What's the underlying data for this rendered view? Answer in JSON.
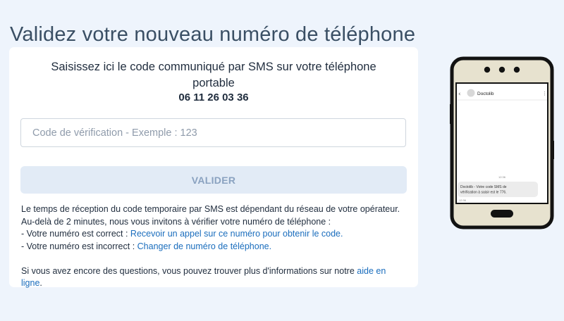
{
  "page": {
    "title": "Validez votre nouveau numéro de téléphone"
  },
  "form": {
    "instruction": "Saisissez ici le code communiqué par SMS sur votre téléphone portable",
    "phone_number": "06 11 26 03 36",
    "code_input": {
      "value": "",
      "placeholder": "Code de vérification - Exemple : 123"
    },
    "validate_label": "VALIDER"
  },
  "info": {
    "paragraph": "Le temps de réception du code temporaire par SMS est dépendant du réseau de votre opérateur. Au-delà de 2 minutes, nous vous invitons à vérifier votre numéro de téléphone :",
    "correct_prefix": "- Votre numéro est correct : ",
    "correct_link": "Recevoir un appel sur ce numéro pour obtenir le code.",
    "incorrect_prefix": "- Votre numéro est incorrect : ",
    "incorrect_link": "Changer de numéro de téléphone.",
    "help_prefix": "Si vous avez encore des questions, vous pouvez trouver plus d'informations sur notre ",
    "help_link": "aide en ligne",
    "help_suffix": "."
  },
  "phone_mockup": {
    "sender": "Doctolib",
    "timestamp_top": "12:36",
    "sms_line1": "Doctolib - Votre code SMS de",
    "sms_line2": "vérification à saisir est le 776.",
    "timestamp_bottom": "12:36"
  },
  "colors": {
    "background": "#eef4fc",
    "link": "#1a6dbd",
    "button_bg": "#e2ebf6",
    "button_text": "#8aa2c0",
    "phone_frame": "#e7e2cf"
  }
}
